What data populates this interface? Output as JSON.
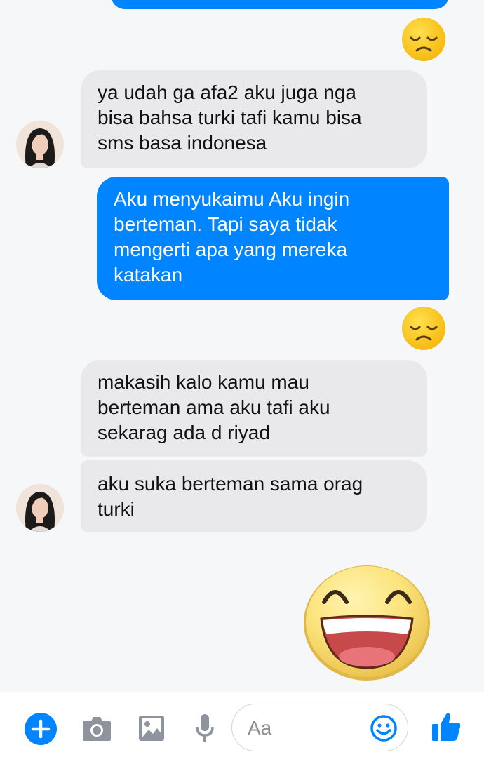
{
  "thread": {
    "messages": [
      {
        "direction": "incoming",
        "text": "ya udah ga afa2 aku juga nga\nbisa bahsa turki tafi kamu bisa\nsms basa indonesa"
      },
      {
        "direction": "outgoing",
        "text": "Aku menyukaimu Aku ingin\nberteman. Tapi saya tidak\nmengerti apa yang mereka\nkatakan"
      },
      {
        "direction": "incoming",
        "text": "makasih kalo kamu mau\nberteman ama aku tafi aku\nsekarag ada d riyad"
      },
      {
        "direction": "incoming",
        "text": "aku suka berteman sama orag\nturki"
      }
    ],
    "reactions": [
      "sad-face-emoji",
      "sad-face-emoji",
      "big-laughing-emoji"
    ]
  },
  "composer": {
    "placeholder": "Aa",
    "icons": [
      "plus-icon",
      "camera-icon",
      "image-icon",
      "microphone-icon",
      "smiley-icon",
      "thumbs-up-icon"
    ]
  },
  "colors": {
    "accent": "#0084ff",
    "incoming_bubble": "#e9e9eb",
    "background": "#f6f7f9"
  }
}
